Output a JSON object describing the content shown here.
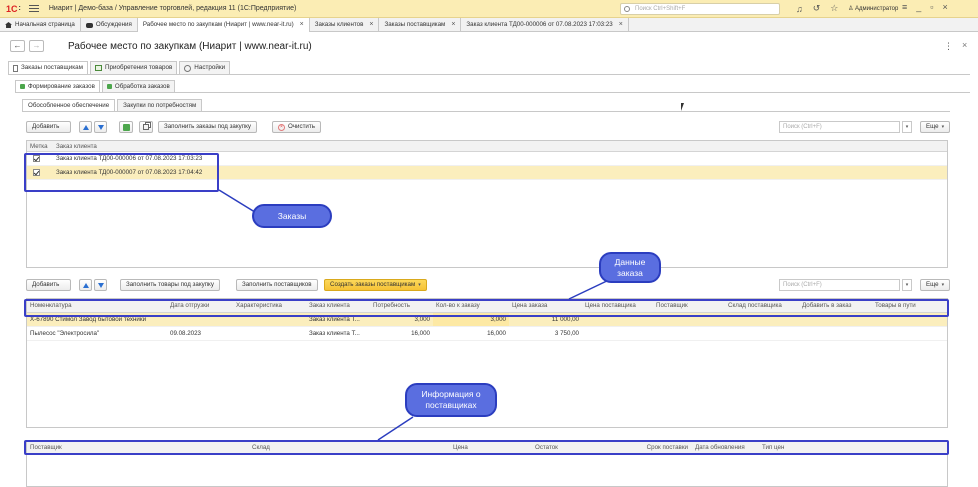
{
  "titlebar": {
    "logo": "1С",
    "app_title": "Ниарит | Демо-база / Управление торговлей, редакция 11  (1С:Предприятие)",
    "search_placeholder": "Поиск Ctrl+Shift+F",
    "user": "Администратор"
  },
  "tabs": [
    {
      "label": "Начальная страница"
    },
    {
      "label": "Обсуждения"
    },
    {
      "label": "Рабочее место по закупкам (Ниарит | www.near-it.ru)"
    },
    {
      "label": "Заказы клиентов"
    },
    {
      "label": "Заказы поставщикам"
    },
    {
      "label": "Заказ клиента ТД00-000006 от 07.08.2023 17:03:23"
    }
  ],
  "page": {
    "title": "Рабочее место по закупкам (Ниарит | www.near-it.ru)",
    "more": "⋮",
    "close": "×"
  },
  "form_tabs": [
    "Заказы поставщикам",
    "Приобретения товаров",
    "Настройки"
  ],
  "sub_tabs": [
    "Формирование заказов",
    "Обработка заказов"
  ],
  "third_tabs": [
    "Обособленное обеспечение",
    "Закупки по потребностям"
  ],
  "toolbar1": {
    "add": "Добавить",
    "fill_orders": "Заполнить заказы под закупку",
    "clear": "Очистить",
    "search": "Поиск (Ctrl+F)",
    "more": "Еще"
  },
  "orders_table": {
    "columns": [
      "Метка",
      "Заказ клиента"
    ],
    "rows": [
      {
        "checked": true,
        "order": "Заказ клиента ТД00-000006 от 07.08.2023 17:03:23"
      },
      {
        "checked": true,
        "order": "Заказ клиента ТД00-000007 от 07.08.2023 17:04:42"
      }
    ]
  },
  "toolbar2": {
    "add": "Добавить",
    "fill_goods": "Заполнить товары под закупку",
    "fill_suppliers": "Заполнить поставщиков",
    "create_orders": "Создать заказы поставщикам",
    "search": "Поиск (Ctrl+F)",
    "more": "Еще"
  },
  "goods_table": {
    "columns": [
      "Номенклатура",
      "Дата отгрузки",
      "Характеристика",
      "Заказ клиента",
      "Потребность",
      "Кол-во к заказу",
      "Цена заказа",
      "Цена поставщика",
      "Поставщик",
      "Склад поставщика",
      "Добавить в заказ",
      "Товары в пути"
    ],
    "rows": [
      [
        "Х-67890 Стимол Завод бытовой техники",
        "",
        "",
        "Заказ клиента Т...",
        "3,000",
        "3,000",
        "11 000,00",
        "",
        "",
        "",
        "",
        ""
      ],
      [
        "Пылесос \"Электросила\"",
        "09.08.2023",
        "",
        "Заказ клиента Т...",
        "16,000",
        "16,000",
        "3 750,00",
        "",
        "",
        "",
        "",
        ""
      ]
    ]
  },
  "suppliers_table": {
    "columns": [
      "Поставщик",
      "Склад",
      "Цена",
      "Остаток",
      "Срок поставки",
      "Дата обновления",
      "Тип цен"
    ]
  },
  "annotations": {
    "orders": "Заказы",
    "order_data": "Данные\nзаказа",
    "supplier_info": "Информация о\nпоставщиках"
  },
  "colors": {
    "accent_blue": "#3a3fc7",
    "callout_fill": "#5a6ee0",
    "selected_row": "#fbeebd",
    "titlebar": "#fbedb4",
    "primary_button": "#f6c236"
  }
}
